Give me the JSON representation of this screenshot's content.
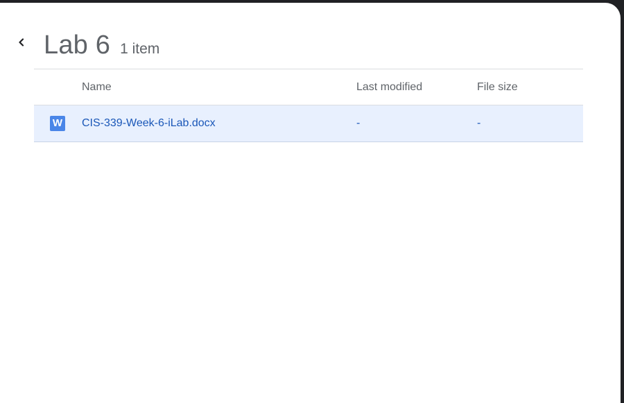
{
  "folder": {
    "title": "Lab 6",
    "item_count": "1 item"
  },
  "table": {
    "columns": {
      "name": "Name",
      "last_modified": "Last modified",
      "file_size": "File size"
    },
    "rows": [
      {
        "icon": "word-doc-icon",
        "icon_letter": "W",
        "name": "CIS-339-Week-6-iLab.docx",
        "last_modified": "-",
        "file_size": "-"
      }
    ]
  },
  "colors": {
    "selected_row_bg": "#e8f0fe",
    "link_text": "#1a57b8",
    "word_icon": "#4a86e8",
    "muted_text": "#5f6368"
  }
}
